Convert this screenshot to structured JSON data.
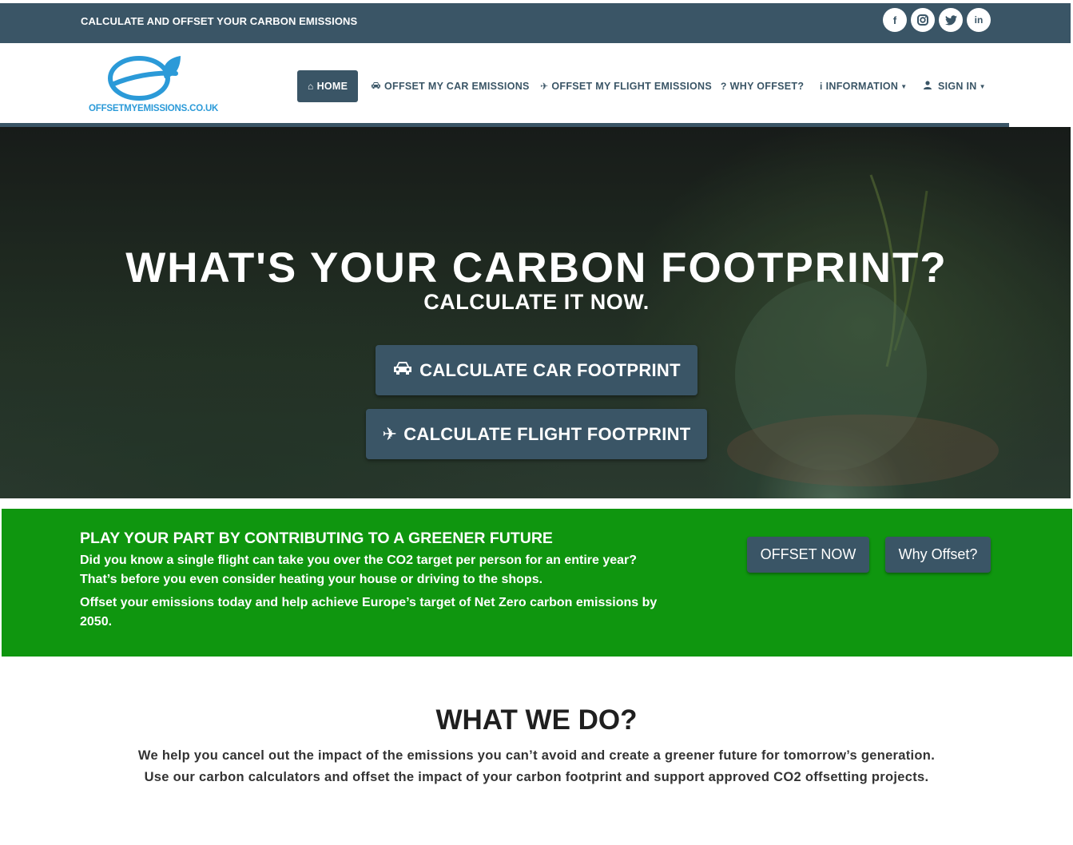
{
  "topbar": {
    "text": "CALCULATE AND OFFSET YOUR CARBON EMISSIONS",
    "social": [
      {
        "icon": "facebook-icon",
        "glyph": "f"
      },
      {
        "icon": "instagram-icon",
        "glyph": "◎"
      },
      {
        "icon": "twitter-icon",
        "glyph": "t"
      },
      {
        "icon": "linkedin-icon",
        "glyph": "in"
      }
    ]
  },
  "brand": {
    "logo_text": "OFFSETMYEMISSIONS.CO.UK",
    "colors": {
      "primary": "#3a5566",
      "logo_blue": "#2b9ad8",
      "green": "#0f960f"
    }
  },
  "nav": {
    "home": "HOME",
    "car": "OFFSET MY CAR EMISSIONS",
    "flight": "OFFSET MY FLIGHT EMISSIONS",
    "why": "WHY OFFSET?",
    "information": "INFORMATION",
    "signin": "SIGN IN"
  },
  "hero": {
    "title": "WHAT'S YOUR CARBON FOOTPRINT?",
    "subtitle": "CALCULATE IT NOW.",
    "car_button": "CALCULATE CAR FOOTPRINT",
    "flight_button": "CALCULATE FLIGHT FOOTPRINT"
  },
  "cta": {
    "title": "PLAY YOUR PART BY CONTRIBUTING TO A GREENER FUTURE",
    "p1": "Did you know a single flight can take you over the CO2 target per person for an entire year? That’s before you even consider heating your house or driving to the shops.",
    "p2": "Offset your emissions today and help achieve Europe’s target of Net Zero carbon emissions by 2050.",
    "offset_button": "OFFSET NOW",
    "why_button": "Why Offset?"
  },
  "what_we_do": {
    "title": "WHAT WE DO?",
    "line1": "We help you cancel out the impact of the emissions you can’t avoid and create a greener future for tomorrow’s generation.",
    "line2": "Use our carbon calculators and offset the impact of your carbon footprint and support approved CO2 offsetting projects."
  }
}
